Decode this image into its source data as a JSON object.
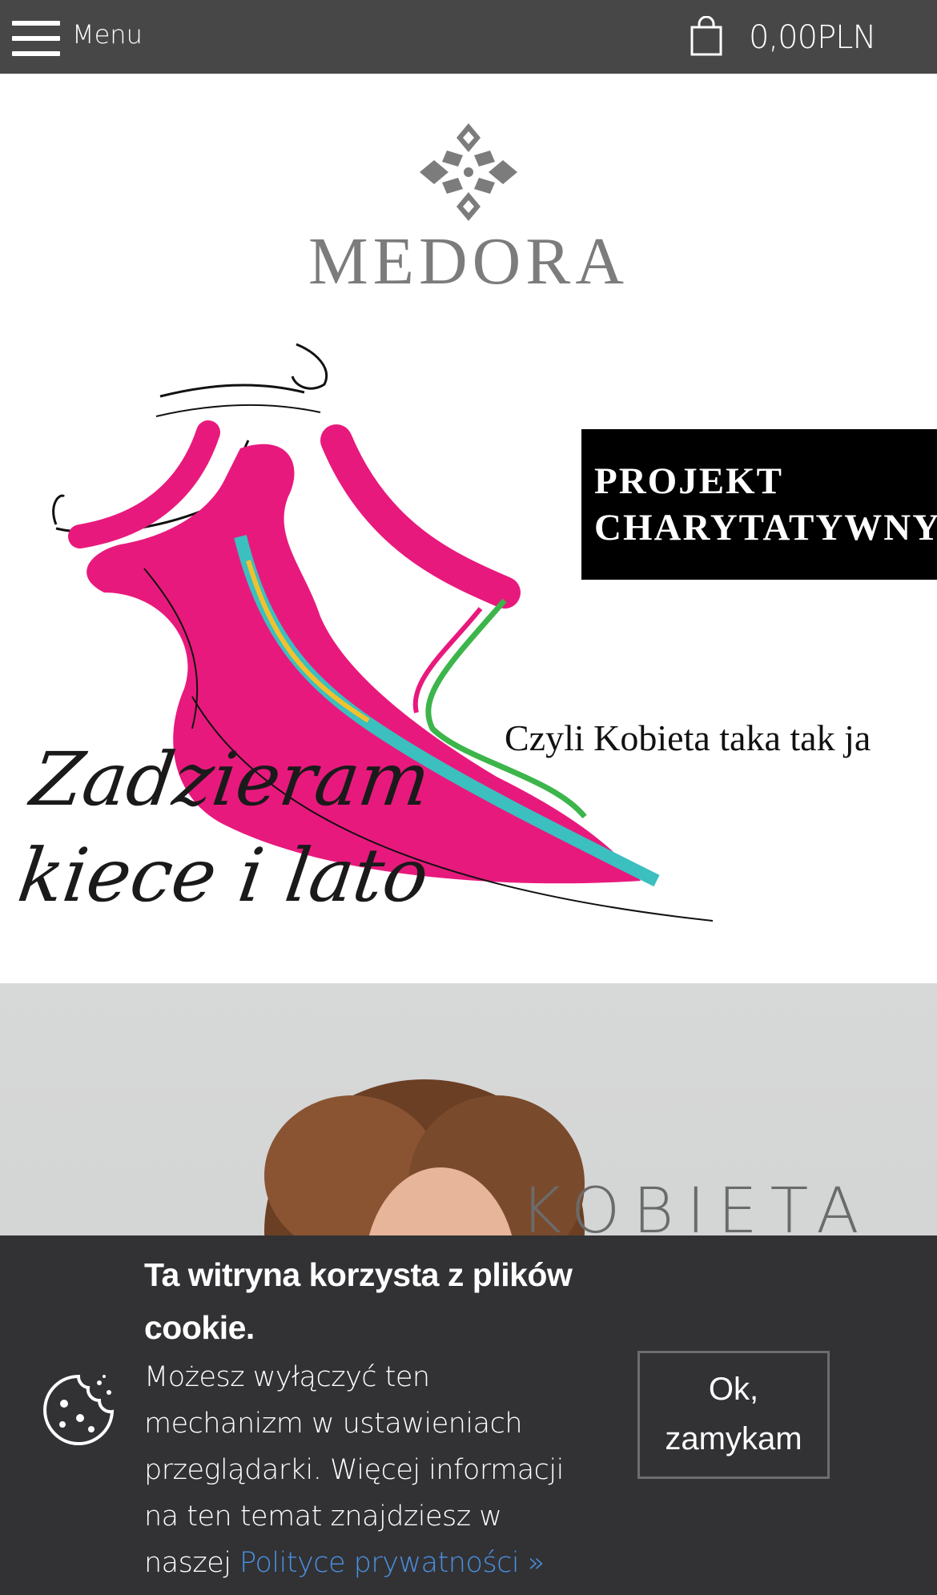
{
  "header": {
    "menu_label": "Menu",
    "cart_total": "0,00PLN",
    "menu_icon": "hamburger-icon",
    "cart_icon": "shopping-bag-icon"
  },
  "logo": {
    "text": "MEDORA",
    "mark_icon": "ornament-logo-icon"
  },
  "banner": {
    "project_line1": "PROJEKT",
    "project_line2": "CHARYTATYWNY",
    "tagline": "Czyli Kobieta taka tak ja",
    "script_line1": "Zadzieram",
    "script_line2": "kiece i lato",
    "colors": {
      "dress": "#e8197d",
      "accent_green": "#3cb54a",
      "accent_teal": "#3bbfbf",
      "accent_yellow": "#f2c12e"
    }
  },
  "hero2": {
    "word": "KOBIETA"
  },
  "cookie": {
    "title": "Ta witryna korzysta z plików cookie.",
    "body": "Możesz wyłączyć ten mechanizm w ustawieniach przeglądarki. Więcej informacji na ten temat znajdziesz w naszej ",
    "link_text": "Polityce prywatności »",
    "button_label": "Ok, zamykam",
    "icon": "cookie-icon"
  }
}
